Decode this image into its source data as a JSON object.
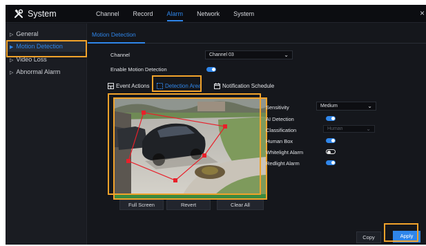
{
  "app": {
    "title": "System",
    "close_glyph": "×"
  },
  "top_nav": [
    {
      "label": "Channel",
      "active": false
    },
    {
      "label": "Record",
      "active": false
    },
    {
      "label": "Alarm",
      "active": true
    },
    {
      "label": "Network",
      "active": false
    },
    {
      "label": "System",
      "active": false
    }
  ],
  "sidebar": {
    "items": [
      {
        "label": "General",
        "active": false
      },
      {
        "label": "Motion Detection",
        "active": true
      },
      {
        "label": "Video Loss",
        "active": false
      },
      {
        "label": "Abnormal Alarm",
        "active": false
      }
    ]
  },
  "sub_tab": {
    "label": "Motion Detection"
  },
  "form": {
    "channel_label": "Channel",
    "channel_value": "Channel 03",
    "enable_label": "Enable Motion Detection",
    "enable_on": true
  },
  "content_tabs": [
    {
      "label": "Event Actions",
      "icon": "event-actions-icon",
      "active": false
    },
    {
      "label": "Detection Area",
      "icon": "detection-area-icon",
      "active": true
    },
    {
      "label": "Notification Schedule",
      "icon": "calendar-icon",
      "active": false
    }
  ],
  "settings": {
    "sensitivity_label": "Sensitivity",
    "sensitivity_value": "Medium",
    "ai_detection_label": "AI Detection",
    "ai_detection_on": true,
    "classification_label": "Classification",
    "classification_value": "Human",
    "human_box_label": "Human Box",
    "human_box_on": true,
    "whitelight_label": "Whitelight Alarm",
    "whitelight_on": false,
    "redlight_label": "Redlight Alarm",
    "redlight_on": true
  },
  "video_buttons": {
    "full_screen": "Full Screen",
    "revert": "Revert",
    "clear_all": "Clear All"
  },
  "footer": {
    "copy": "Copy",
    "apply": "Apply"
  },
  "colors": {
    "accent": "#2f86ea",
    "highlight": "#f2a32b",
    "region": "#e8202a",
    "background": "#15171c"
  }
}
